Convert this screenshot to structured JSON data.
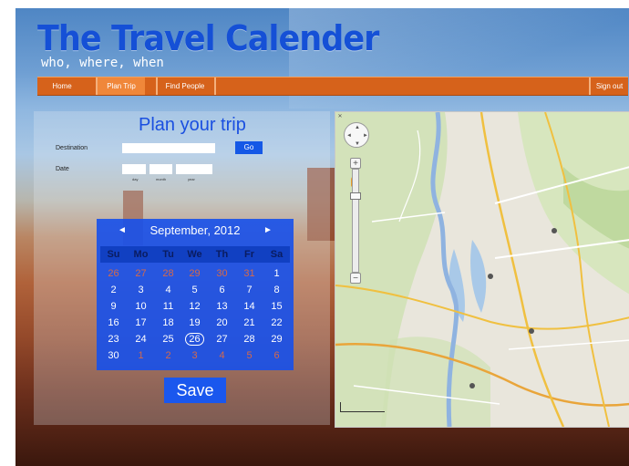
{
  "header": {
    "title": "The Travel Calender",
    "tagline": "who, where, when"
  },
  "nav": {
    "items": [
      {
        "label": "Home"
      },
      {
        "label": "Plan Trip",
        "active": true
      },
      {
        "label": "Find People"
      }
    ],
    "sign_out_label": "Sign out"
  },
  "plan": {
    "heading": "Plan your trip",
    "destination_label": "Destination",
    "destination_value": "",
    "go_label": "Go",
    "date_label": "Date",
    "date_hints": [
      "day",
      "month",
      "year"
    ],
    "save_label": "Save"
  },
  "calendar": {
    "month_label": "September, 2012",
    "prev_arrow": "◄",
    "next_arrow": "►",
    "weekdays": [
      "Su",
      "Mo",
      "Tu",
      "We",
      "Th",
      "Fr",
      "Sa"
    ],
    "selected_day": "26",
    "weeks": [
      [
        "26",
        "27",
        "28",
        "29",
        "30",
        "31",
        "1"
      ],
      [
        "2",
        "3",
        "4",
        "5",
        "6",
        "7",
        "8"
      ],
      [
        "9",
        "10",
        "11",
        "12",
        "13",
        "14",
        "15"
      ],
      [
        "16",
        "17",
        "18",
        "19",
        "20",
        "21",
        "22"
      ],
      [
        "23",
        "24",
        "25",
        "26",
        "27",
        "28",
        "29"
      ],
      [
        "30",
        "1",
        "2",
        "3",
        "4",
        "5",
        "6"
      ]
    ]
  },
  "colors": {
    "brand_blue": "#1550d6",
    "nav_orange": "#d6621b",
    "calendar_blue": "#1650eb"
  }
}
